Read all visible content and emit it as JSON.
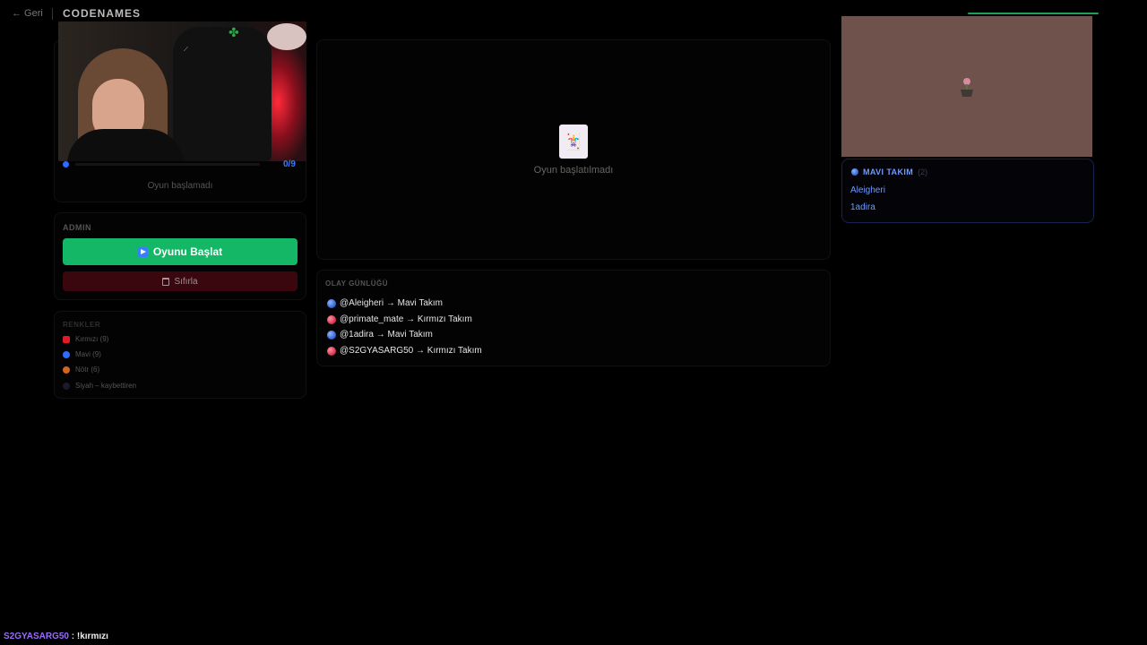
{
  "header": {
    "back_label": "← Geri",
    "title": "CODENAMES"
  },
  "left": {
    "progress_text": "0/9",
    "status_text": "Oyun başlamadı",
    "admin": {
      "heading": "ADMIN",
      "start_label": "Oyunu Başlat",
      "reset_label": "Sıfırla"
    },
    "colors": {
      "heading": "RENKLER",
      "items": [
        {
          "label": "Kırmızı (9)",
          "color": "#e01b24"
        },
        {
          "label": "Mavi (9)",
          "color": "#2e6bff"
        },
        {
          "label": "Nötr (6)",
          "color": "#d4651f"
        },
        {
          "label": "Siyah – kaybettiren",
          "color": "#1a1a2a"
        }
      ]
    }
  },
  "board": {
    "status_text": "Oyun başlatılmadı"
  },
  "log": {
    "heading": "OLAY GÜNLÜĞÜ",
    "entries": [
      {
        "text": "@Aleigheri → Mavi Takım",
        "team": "blue"
      },
      {
        "text": "@primate_mate → Kırmızı Takım",
        "team": "red"
      },
      {
        "text": "@1adira → Mavi Takım",
        "team": "blue"
      },
      {
        "text": "@S2GYASARG50 → Kırmızı Takım",
        "team": "red"
      }
    ]
  },
  "right": {
    "team": {
      "name": "MAVI TAKIM",
      "count": "(2)",
      "members": [
        "Aleigheri",
        "1adira"
      ]
    }
  },
  "chat": {
    "user": "S2GYASARG50",
    "separator": " : ",
    "message": "!kırmızı",
    "user_color": "#9b6bff"
  }
}
